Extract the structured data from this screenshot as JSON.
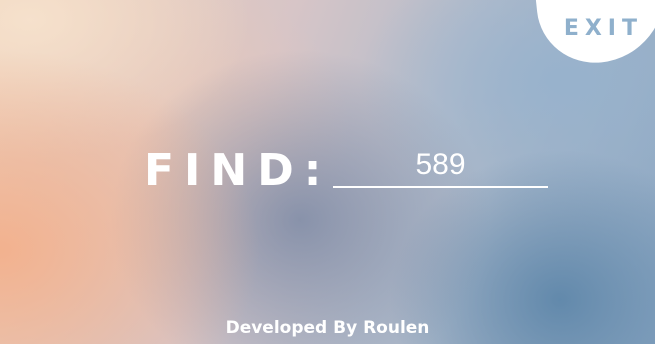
{
  "header": {
    "exit_label": "EXIT"
  },
  "search": {
    "label": "FIND:",
    "value": "589"
  },
  "footer": {
    "credit": "Developed By Roulen"
  },
  "colors": {
    "exit_text": "#8fb0cc",
    "foreground": "#ffffff"
  }
}
